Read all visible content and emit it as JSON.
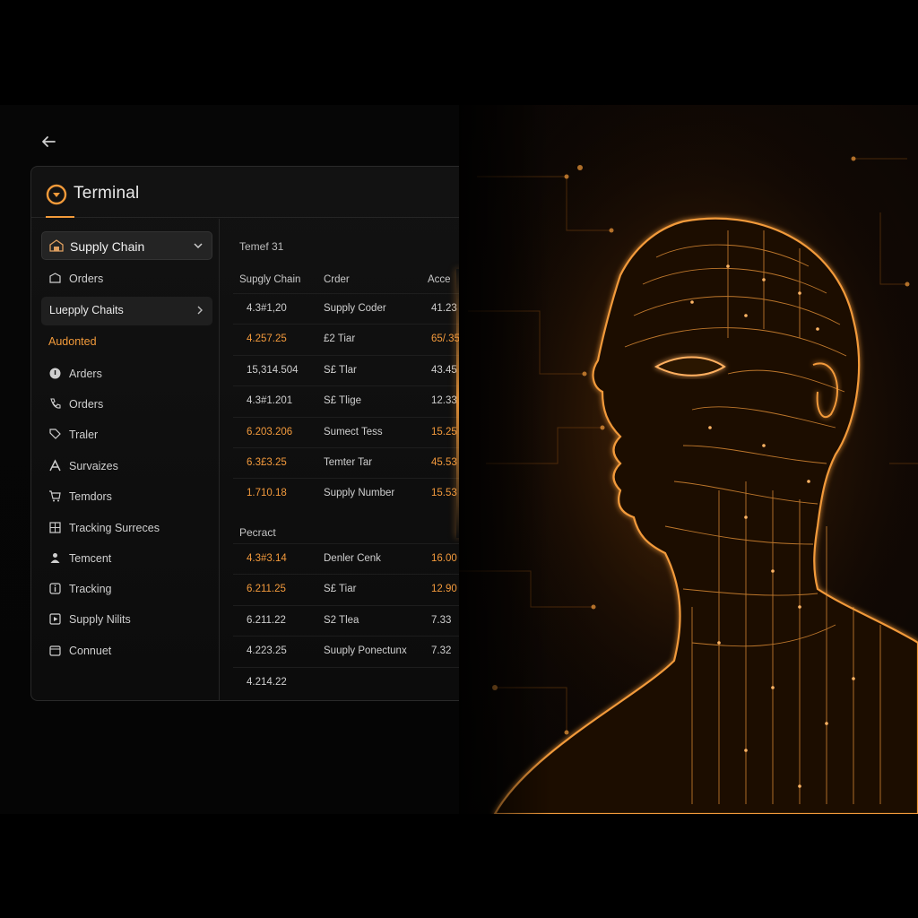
{
  "header": {
    "app_title": "Terminal"
  },
  "sidebar": {
    "selector": {
      "label": "Supply Chain"
    },
    "items_top": [
      {
        "label": "Orders",
        "icon": "box-icon"
      }
    ],
    "active_item": {
      "label": "Luepply Chaits"
    },
    "section_label": "Audonted",
    "items": [
      {
        "label": "Arders",
        "icon": "circle-info-icon"
      },
      {
        "label": "Orders",
        "icon": "phone-icon"
      },
      {
        "label": "Traler",
        "icon": "tag-icon"
      },
      {
        "label": "Survaizes",
        "icon": "letter-a-icon"
      },
      {
        "label": "Temdors",
        "icon": "cart-icon"
      },
      {
        "label": "Tracking Surreces",
        "icon": "grid-icon"
      },
      {
        "label": "Temcent",
        "icon": "person-icon"
      },
      {
        "label": "Tracking",
        "icon": "info-square-icon"
      },
      {
        "label": "Supply Nilits",
        "icon": "play-square-icon"
      },
      {
        "label": "Connuet",
        "icon": "box-outline-icon"
      }
    ]
  },
  "content": {
    "title": "Temef 31",
    "columns": [
      "Supgly Chain",
      "Crder",
      "Acce"
    ],
    "rows": [
      {
        "c1": "4.3#1,20",
        "c2": "Supply Coder",
        "c3": "41.23",
        "orange": false
      },
      {
        "c1": "4.257.25",
        "c2": "£2 Tiar",
        "c3": "65/.35",
        "orange": true
      },
      {
        "c1": "15,314.504",
        "c2": "S£ Tlar",
        "c3": "43.45",
        "orange": false
      },
      {
        "c1": "4.3#1.201",
        "c2": "S£ Tlige",
        "c3": "12.33",
        "orange": false
      },
      {
        "c1": "6.203.206",
        "c2": "Sumect Tess",
        "c3": "15.25",
        "orange": true
      },
      {
        "c1": "6.3£3.25",
        "c2": "Temter Tar",
        "c3": "45.53",
        "orange": true
      },
      {
        "c1": "1.710.18",
        "c2": "Supply Number",
        "c3": "15.53",
        "orange": true
      }
    ],
    "section_label": "Pecract",
    "rows2": [
      {
        "c1": "4.3#3.14",
        "c2": "Denler Cenk",
        "c3": "16.00",
        "orange": true
      },
      {
        "c1": "6.211.25",
        "c2": "S£ Tiar",
        "c3": "12.90",
        "orange": true
      },
      {
        "c1": "6.211.22",
        "c2": "S2 Tlea",
        "c3": "7.33",
        "orange": false
      },
      {
        "c1": "4.223.25",
        "c2": "Suuply Ponectunx",
        "c3": "7.32",
        "orange": false
      },
      {
        "c1": "4.214.22",
        "c2": "",
        "c3": "",
        "orange": false
      }
    ]
  },
  "colors": {
    "accent": "#f29a3a",
    "background": "#000000",
    "panel": "#121212"
  }
}
